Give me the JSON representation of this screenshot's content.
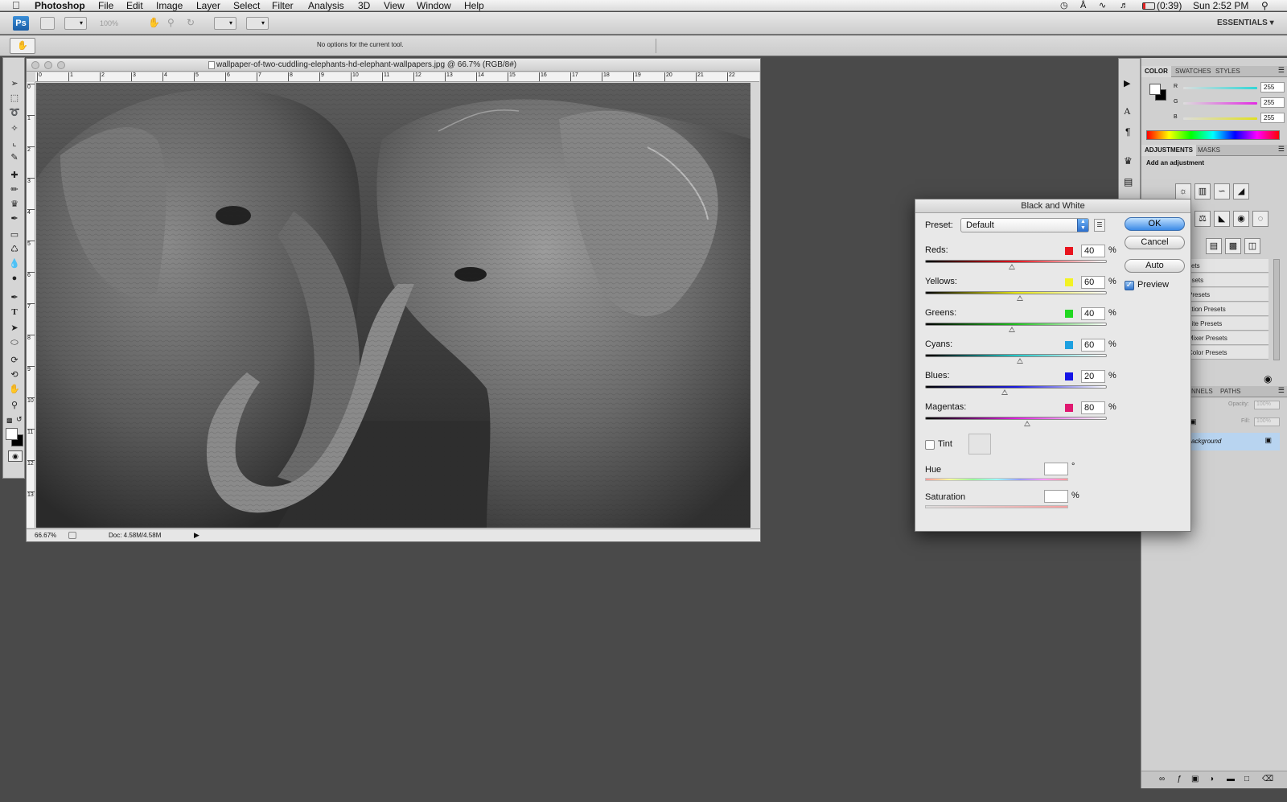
{
  "menubar": {
    "apple": "",
    "app": "Photoshop",
    "items": [
      "File",
      "Edit",
      "Image",
      "Layer",
      "Select",
      "Filter",
      "Analysis",
      "3D",
      "View",
      "Window",
      "Help"
    ],
    "battery": "(0:39)",
    "clock": "Sun 2:52 PM"
  },
  "appbar": {
    "logo": "Ps",
    "zoom": "100%",
    "workspace": "ESSENTIALS ▾"
  },
  "options": {
    "message": "No options for the current tool."
  },
  "document": {
    "title": "wallpaper-of-two-cuddling-elephants-hd-elephant-wallpapers.jpg @ 66.7% (RGB/8#)",
    "ruler_top": [
      "0",
      "1",
      "2",
      "3",
      "4",
      "5",
      "6",
      "7",
      "8",
      "9",
      "10",
      "11",
      "12",
      "13",
      "14",
      "15",
      "16",
      "17",
      "18",
      "19",
      "20",
      "21",
      "22"
    ],
    "ruler_left": [
      "0",
      "1",
      "2",
      "3",
      "4",
      "5",
      "6",
      "7",
      "8",
      "9",
      "10",
      "11",
      "12",
      "13"
    ],
    "zoom": "66.67%",
    "doc_info": "Doc: 4.58M/4.58M"
  },
  "color_panel": {
    "tabs": [
      "COLOR",
      "SWATCHES",
      "STYLES"
    ],
    "channels": [
      {
        "label": "R",
        "value": "255",
        "color": "#2fd6d6"
      },
      {
        "label": "G",
        "value": "255",
        "color": "#e22ce2"
      },
      {
        "label": "B",
        "value": "255",
        "color": "#e0e020"
      }
    ]
  },
  "adjustments_panel": {
    "tabs": [
      "ADJUSTMENTS",
      "MASKS"
    ],
    "heading": "Add an adjustment",
    "presets": [
      "sets",
      "esets",
      "Presets",
      "ation Presets",
      "hite Presets",
      "Mixer Presets",
      "Color Presets"
    ]
  },
  "layers_panel": {
    "tabs": [
      "NNELS",
      "PATHS"
    ],
    "opacity_label": "Opacity:",
    "opacity_value": "100%",
    "fill_label": "Fill:",
    "fill_value": "100%",
    "layer_name": "ackground"
  },
  "dialog": {
    "title": "Black and White",
    "preset_label": "Preset:",
    "preset_value": "Default",
    "buttons": {
      "ok": "OK",
      "cancel": "Cancel",
      "auto": "Auto"
    },
    "preview_label": "Preview",
    "preview_checked": true,
    "percent": "%",
    "sliders": [
      {
        "label": "Reds:",
        "value": "40",
        "swatch": "#e8141e",
        "gradient": "linear-gradient(90deg,#000,#e8141e,#fff)",
        "pos": 0.48
      },
      {
        "label": "Yellows:",
        "value": "60",
        "swatch": "#f2f224",
        "gradient": "linear-gradient(90deg,#000,#e6e612,#fff)",
        "pos": 0.52
      },
      {
        "label": "Greens:",
        "value": "40",
        "swatch": "#22d822",
        "gradient": "linear-gradient(90deg,#000,#1fc21f,#fff)",
        "pos": 0.48
      },
      {
        "label": "Cyans:",
        "value": "60",
        "swatch": "#1ea0e0",
        "gradient": "linear-gradient(90deg,#000,#22c9c9,#fff)",
        "pos": 0.52
      },
      {
        "label": "Blues:",
        "value": "20",
        "swatch": "#1414e6",
        "gradient": "linear-gradient(90deg,#000,#1a1ae0,#fff)",
        "pos": 0.44
      },
      {
        "label": "Magentas:",
        "value": "80",
        "swatch": "#e01870",
        "gradient": "linear-gradient(90deg,#000,#e020e0,#fff)",
        "pos": 0.56
      }
    ],
    "tint_label": "Tint",
    "tint_checked": false,
    "hue_label": "Hue",
    "hue_value": "",
    "hue_unit": "°",
    "saturation_label": "Saturation",
    "saturation_value": "",
    "saturation_unit": "%"
  }
}
